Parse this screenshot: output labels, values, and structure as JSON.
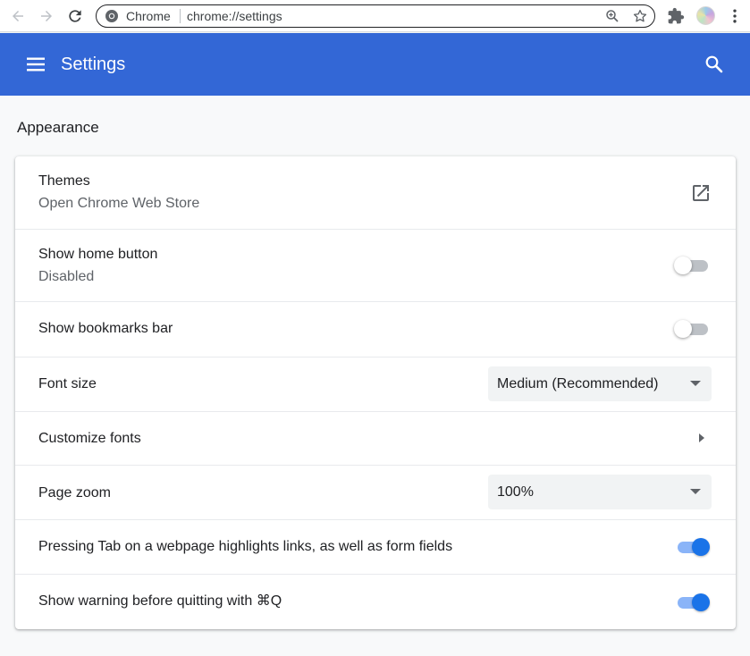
{
  "browser": {
    "back_icon": "arrow-left-icon",
    "forward_icon": "arrow-right-icon",
    "reload_icon": "reload-icon",
    "site_label": "Chrome",
    "url": "chrome://settings",
    "zoom_icon": "zoom-in-icon",
    "bookmark_icon": "star-icon",
    "extensions_icon": "puzzle-icon",
    "menu_icon": "three-dots-icon"
  },
  "header": {
    "title": "Settings",
    "background": "#3367d6",
    "menu_icon": "hamburger-icon",
    "search_icon": "search-icon"
  },
  "appearance": {
    "section_title": "Appearance",
    "themes": {
      "label": "Themes",
      "sublabel": "Open Chrome Web Store",
      "icon": "external-link-icon"
    },
    "show_home_button": {
      "label": "Show home button",
      "sublabel": "Disabled",
      "enabled": false
    },
    "show_bookmarks_bar": {
      "label": "Show bookmarks bar",
      "enabled": false
    },
    "font_size": {
      "label": "Font size",
      "value": "Medium (Recommended)"
    },
    "customize_fonts": {
      "label": "Customize fonts",
      "icon": "chevron-right-icon"
    },
    "page_zoom": {
      "label": "Page zoom",
      "value": "100%"
    },
    "tab_highlights": {
      "label": "Pressing Tab on a webpage highlights links, as well as form fields",
      "enabled": true
    },
    "warn_before_quit": {
      "label": "Show warning before quitting with ⌘Q",
      "enabled": true
    }
  },
  "colors": {
    "accent": "#1a73e8",
    "toggle_on_track": "#8ab4f8",
    "toggle_off_track": "#bdc1c6"
  }
}
